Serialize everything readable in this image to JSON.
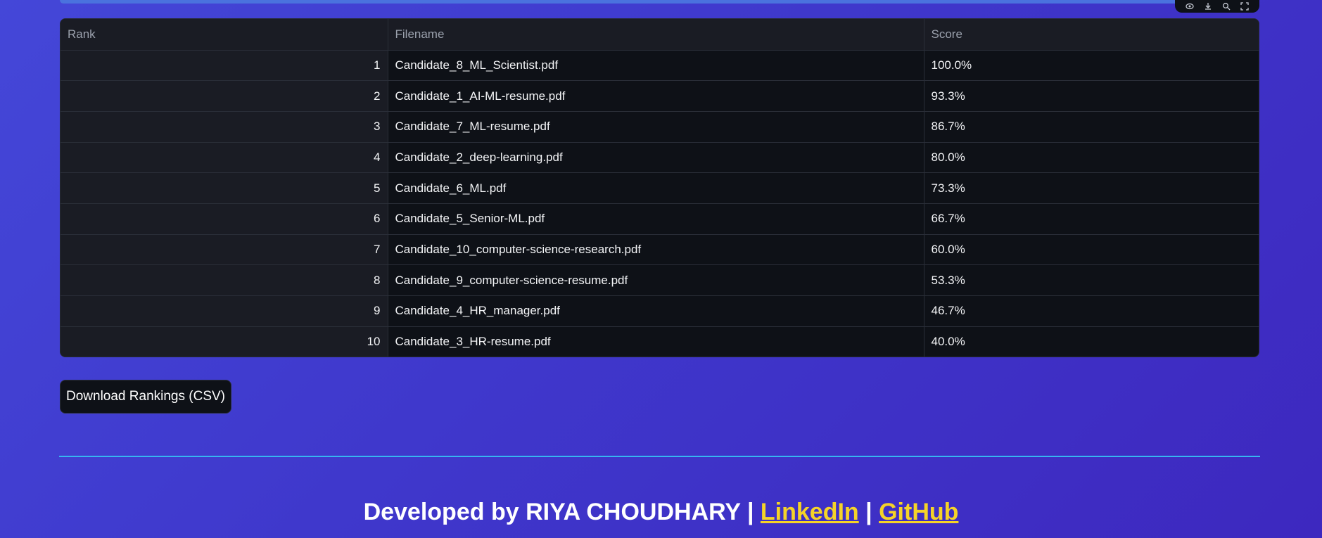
{
  "table": {
    "headers": {
      "rank": "Rank",
      "filename": "Filename",
      "score": "Score"
    },
    "rows": [
      {
        "rank": "1",
        "filename": "Candidate_8_ML_Scientist.pdf",
        "score": "100.0%"
      },
      {
        "rank": "2",
        "filename": "Candidate_1_AI-ML-resume.pdf",
        "score": "93.3%"
      },
      {
        "rank": "3",
        "filename": "Candidate_7_ML-resume.pdf",
        "score": "86.7%"
      },
      {
        "rank": "4",
        "filename": "Candidate_2_deep-learning.pdf",
        "score": "80.0%"
      },
      {
        "rank": "5",
        "filename": "Candidate_6_ML.pdf",
        "score": "73.3%"
      },
      {
        "rank": "6",
        "filename": "Candidate_5_Senior-ML.pdf",
        "score": "66.7%"
      },
      {
        "rank": "7",
        "filename": "Candidate_10_computer-science-research.pdf",
        "score": "60.0%"
      },
      {
        "rank": "8",
        "filename": "Candidate_9_computer-science-resume.pdf",
        "score": "53.3%"
      },
      {
        "rank": "9",
        "filename": "Candidate_4_HR_manager.pdf",
        "score": "46.7%"
      },
      {
        "rank": "10",
        "filename": "Candidate_3_HR-resume.pdf",
        "score": "40.0%"
      }
    ]
  },
  "toolbar": {
    "icons": [
      "eye-icon",
      "download-icon",
      "search-icon",
      "fullscreen-icon"
    ]
  },
  "download_button": {
    "label": "Download Rankings (CSV)"
  },
  "footer": {
    "prefix": "Developed by RIYA CHOUDHARY",
    "separator1": " | ",
    "linkedin": "LinkedIn",
    "separator2": " | ",
    "github": "GitHub"
  },
  "colors": {
    "background_start": "#4447d8",
    "background_end": "#3d28bf",
    "table_bg": "#0e1117",
    "link": "#f5d328",
    "divider": "#36b6f0"
  }
}
